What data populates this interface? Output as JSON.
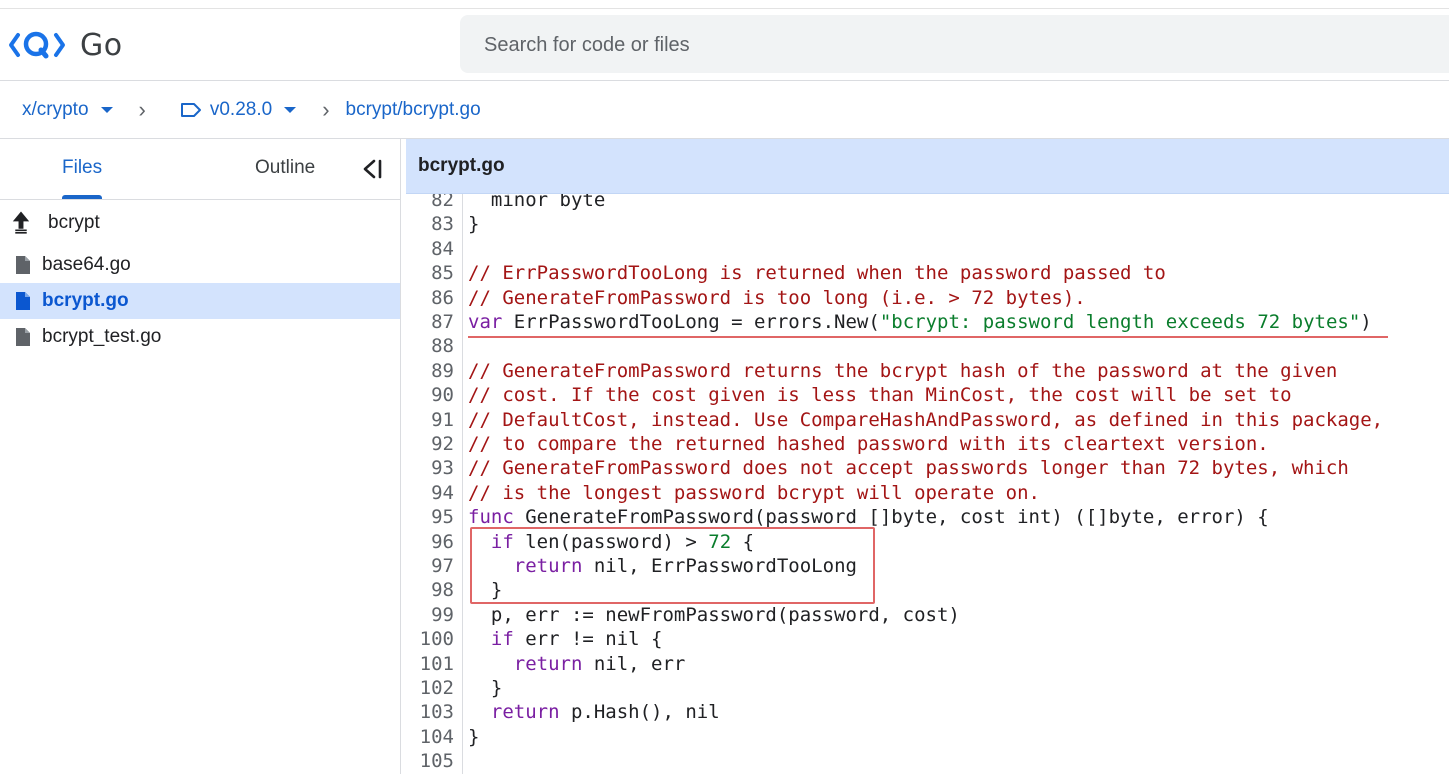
{
  "app": {
    "logo_text": "Go"
  },
  "search": {
    "placeholder": "Search for code or files"
  },
  "breadcrumbs": {
    "repo": "x/crypto",
    "version": "v0.28.0",
    "path": "bcrypt/bcrypt.go"
  },
  "sidebar": {
    "tabs": {
      "files": "Files",
      "outline": "Outline"
    },
    "parent": "bcrypt",
    "files": [
      {
        "name": "base64.go",
        "selected": false
      },
      {
        "name": "bcrypt.go",
        "selected": true
      },
      {
        "name": "bcrypt_test.go",
        "selected": false
      }
    ]
  },
  "editor": {
    "filename": "bcrypt.go",
    "lines": [
      {
        "n": "82",
        "t": "  minor byte"
      },
      {
        "n": "83",
        "t": "}"
      },
      {
        "n": "84",
        "t": ""
      },
      {
        "n": "85",
        "t": "// ErrPasswordTooLong is returned when the password passed to"
      },
      {
        "n": "86",
        "t": "// GenerateFromPassword is too long (i.e. > 72 bytes)."
      },
      {
        "n": "87",
        "t": "var ErrPasswordTooLong = errors.New(\"bcrypt: password length exceeds 72 bytes\")"
      },
      {
        "n": "88",
        "t": ""
      },
      {
        "n": "89",
        "t": "// GenerateFromPassword returns the bcrypt hash of the password at the given"
      },
      {
        "n": "90",
        "t": "// cost. If the cost given is less than MinCost, the cost will be set to"
      },
      {
        "n": "91",
        "t": "// DefaultCost, instead. Use CompareHashAndPassword, as defined in this package,"
      },
      {
        "n": "92",
        "t": "// to compare the returned hashed password with its cleartext version."
      },
      {
        "n": "93",
        "t": "// GenerateFromPassword does not accept passwords longer than 72 bytes, which"
      },
      {
        "n": "94",
        "t": "// is the longest password bcrypt will operate on."
      },
      {
        "n": "95",
        "t": "func GenerateFromPassword(password []byte, cost int) ([]byte, error) {"
      },
      {
        "n": "96",
        "t": "  if len(password) > 72 {"
      },
      {
        "n": "97",
        "t": "    return nil, ErrPasswordTooLong"
      },
      {
        "n": "98",
        "t": "  }"
      },
      {
        "n": "99",
        "t": "  p, err := newFromPassword(password, cost)"
      },
      {
        "n": "100",
        "t": "  if err != nil {"
      },
      {
        "n": "101",
        "t": "    return nil, err"
      },
      {
        "n": "102",
        "t": "  }"
      },
      {
        "n": "103",
        "t": "  return p.Hash(), nil"
      },
      {
        "n": "104",
        "t": "}"
      },
      {
        "n": "105",
        "t": ""
      }
    ]
  },
  "colors": {
    "accent": "#1a66c9",
    "selected_bg": "#d3e3fd",
    "comment": "#a31515",
    "keyword": "#7a1fa2",
    "string": "#0a7d2c",
    "highlight": "#e06666"
  }
}
